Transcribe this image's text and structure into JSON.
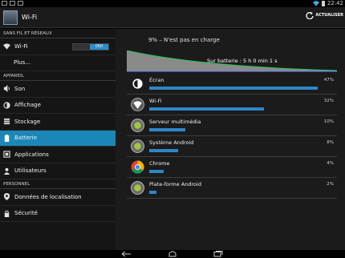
{
  "status_bar": {
    "time": "22:42"
  },
  "action_bar": {
    "title": "Wi-Fi",
    "refresh_label": "ACTUALISER"
  },
  "sidebar": {
    "sections": [
      {
        "header": "SANS FIL ET RÉSEAUX",
        "items": [
          {
            "label": "Wi-Fi",
            "icon": "wifi-icon",
            "toggle": "OUI"
          },
          {
            "label": "Plus...",
            "icon": ""
          }
        ]
      },
      {
        "header": "APPAREIL",
        "items": [
          {
            "label": "Son",
            "icon": "speaker-icon"
          },
          {
            "label": "Affichage",
            "icon": "brightness-icon"
          },
          {
            "label": "Stockage",
            "icon": "storage-icon"
          },
          {
            "label": "Batterie",
            "icon": "battery-icon",
            "selected": true
          },
          {
            "label": "Applications",
            "icon": "apps-icon"
          },
          {
            "label": "Utilisateurs",
            "icon": "users-icon"
          }
        ]
      },
      {
        "header": "PERSONNEL",
        "items": [
          {
            "label": "Données de localisation",
            "icon": "location-icon"
          },
          {
            "label": "Sécurité",
            "icon": "lock-icon"
          }
        ]
      }
    ]
  },
  "battery": {
    "status": "9% – N'est pas en charge",
    "graph_label": "Sur batterie : 5 h 0 min 1 s",
    "level_percent": 9,
    "usage": [
      {
        "name": "Écran",
        "percent": "47%",
        "value": 47,
        "icon": "brightness-icon"
      },
      {
        "name": "Wi-Fi",
        "percent": "32%",
        "value": 32,
        "icon": "wifi-icon"
      },
      {
        "name": "Serveur multimédia",
        "percent": "10%",
        "value": 10,
        "icon": "android-icon"
      },
      {
        "name": "Système Android",
        "percent": "8%",
        "value": 8,
        "icon": "android-icon"
      },
      {
        "name": "Chrome",
        "percent": "4%",
        "value": 4,
        "icon": "chrome-icon"
      },
      {
        "name": "Plate-forme Android",
        "percent": "2%",
        "value": 2,
        "icon": "android-icon"
      }
    ]
  },
  "colors": {
    "accent": "#1b87b9",
    "bar": "#2f86c6",
    "graph_line": "#22c55e"
  }
}
